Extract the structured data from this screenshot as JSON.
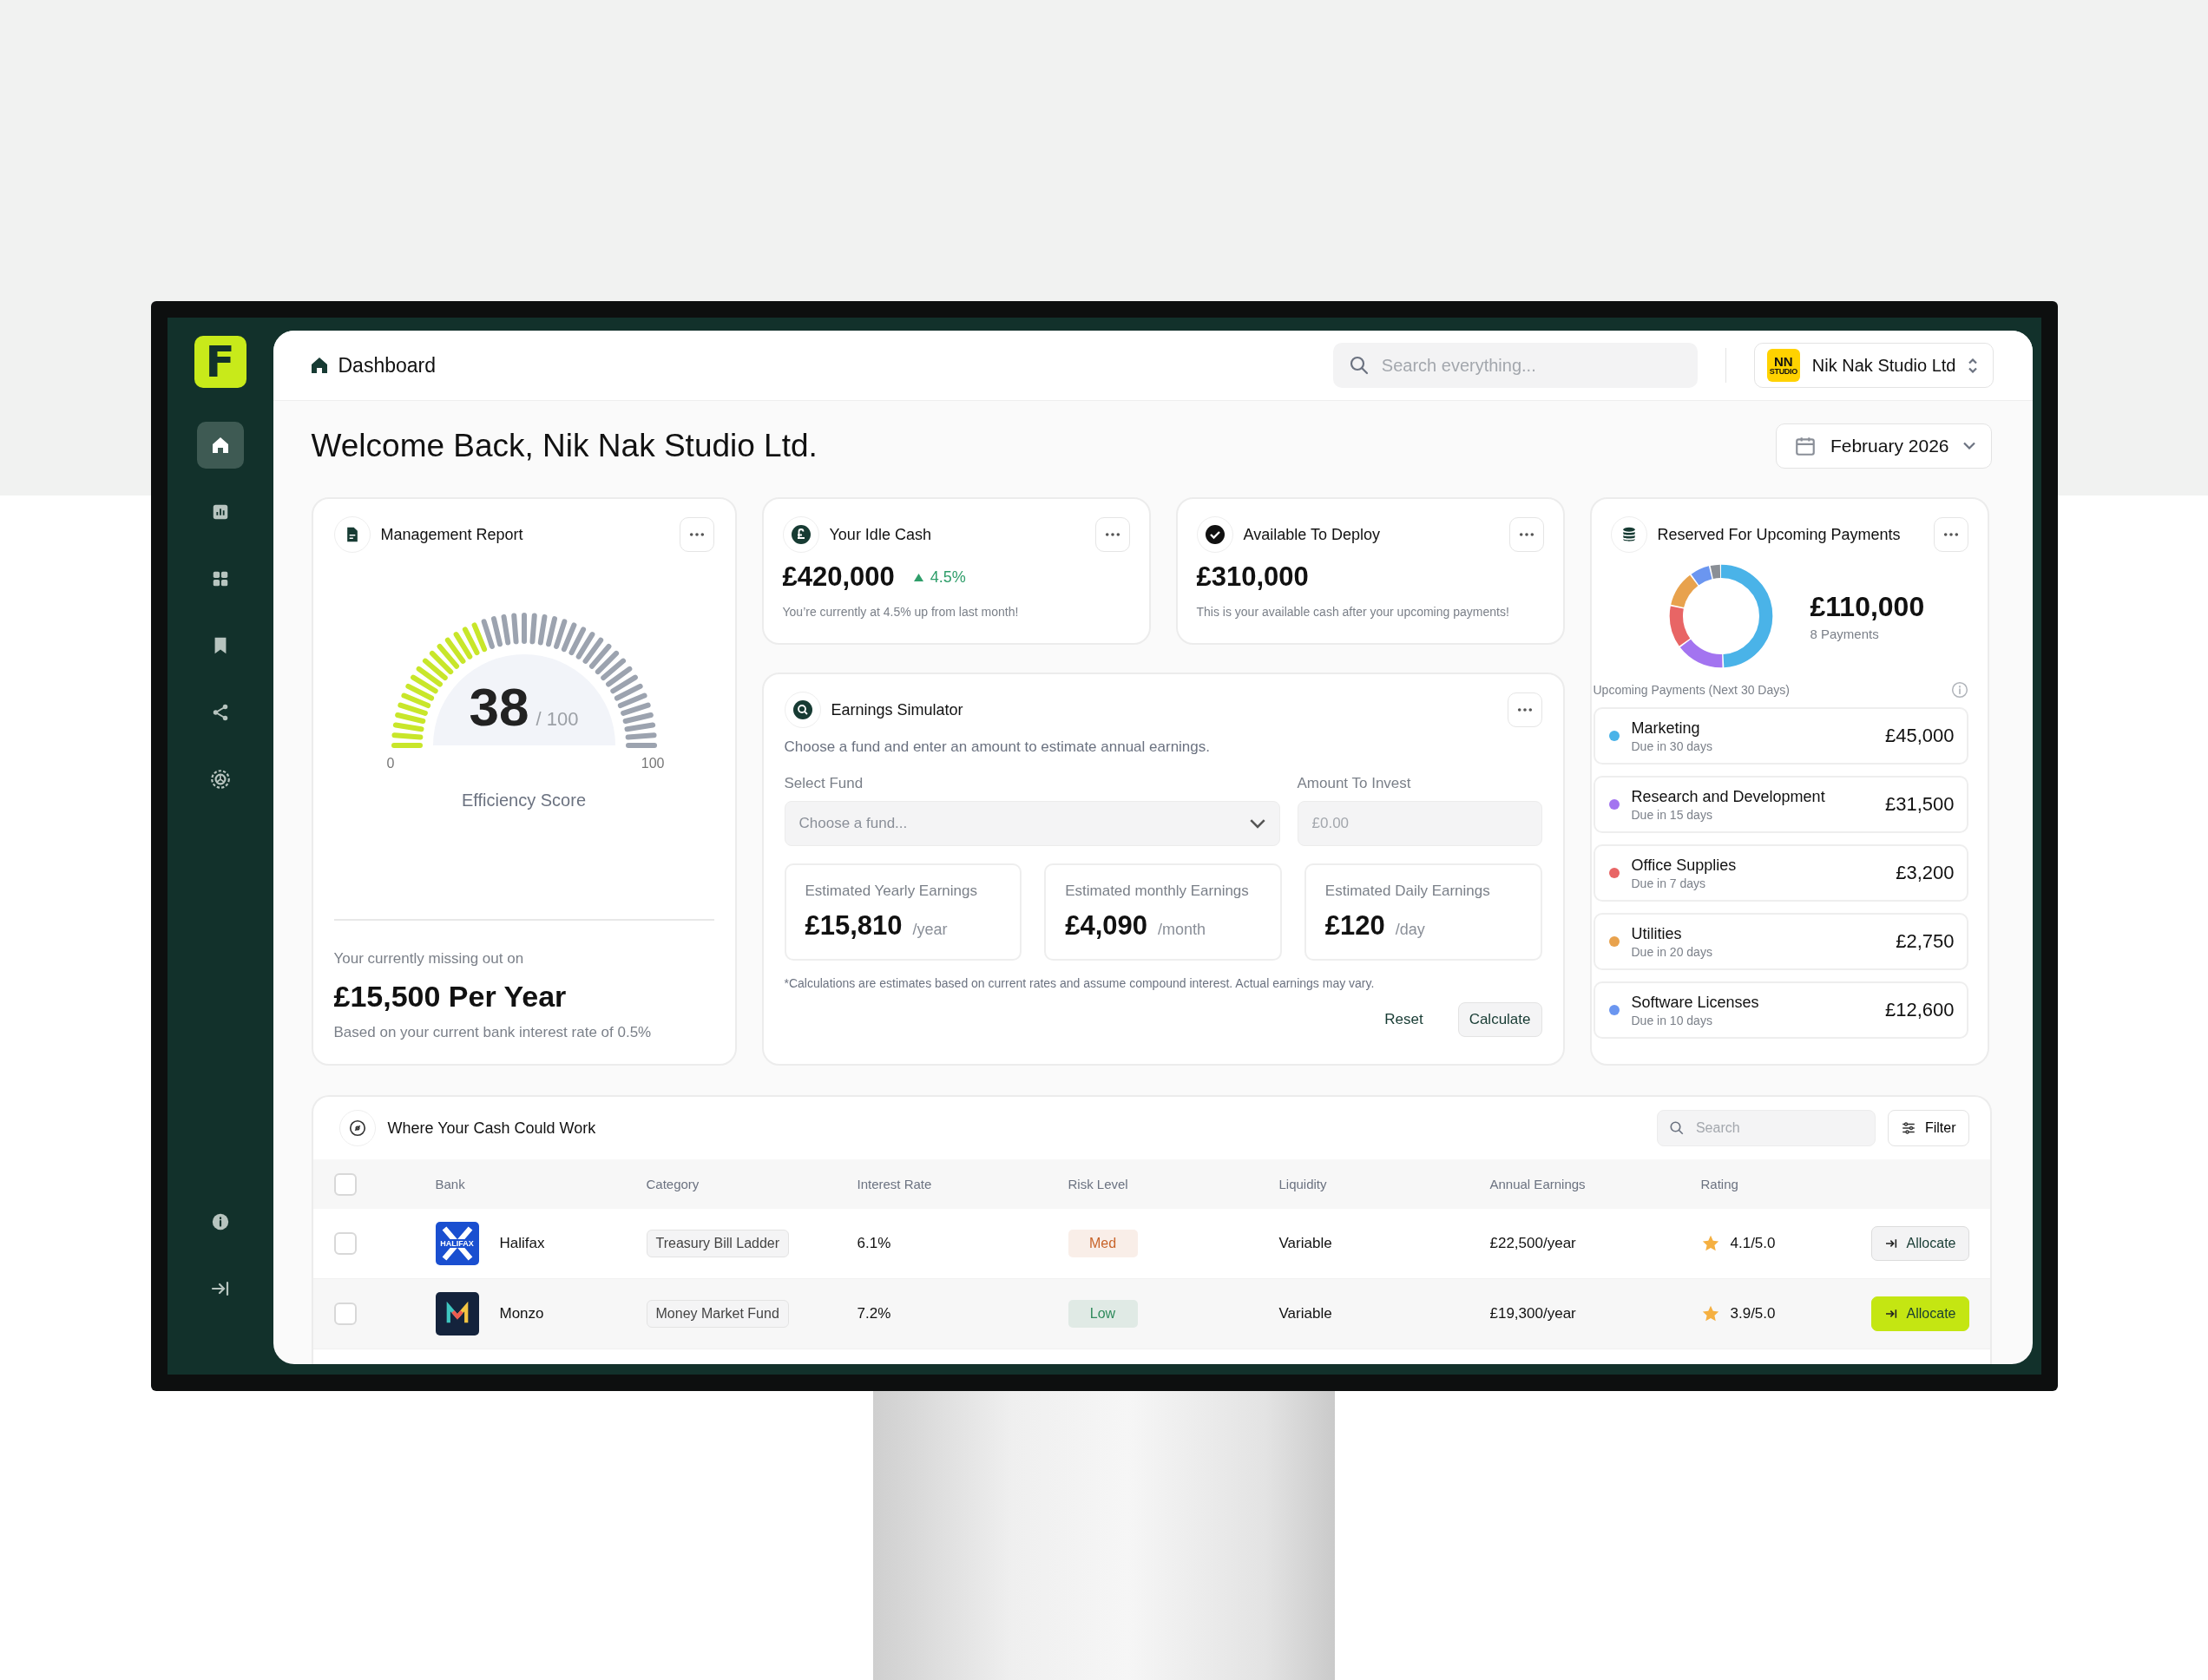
{
  "sidebar": {
    "logo": "F",
    "nav": [
      {
        "kind": "home",
        "selected": true
      },
      {
        "kind": "chart",
        "selected": false
      },
      {
        "kind": "grid",
        "selected": false
      },
      {
        "kind": "bookmark",
        "selected": false
      },
      {
        "kind": "share",
        "selected": false
      },
      {
        "kind": "settings",
        "selected": false
      }
    ],
    "footer": [
      {
        "kind": "info"
      },
      {
        "kind": "collapse"
      }
    ]
  },
  "header": {
    "title": "Dashboard",
    "search": {
      "placeholder": "Search everything..."
    },
    "company": {
      "logo_text": "NN",
      "logo_subtext": "STUDIO",
      "name": "Nik Nak Studio Ltd"
    }
  },
  "welcome": "Welcome Back, Nik Nak Studio Ltd.",
  "period": "February 2026",
  "management_report": {
    "title": "Management Report",
    "gauge": {
      "score": "38",
      "max": "/ 100",
      "min_label": "0",
      "max_label": "100",
      "level": 0.38,
      "caption": "Efficiency Score"
    },
    "missing_label": "Your currently missing out on",
    "missing_value": "£15,500 Per Year",
    "note": "Based on your current bank interest rate of 0.5%"
  },
  "idle_cash": {
    "title": "Your Idle Cash",
    "value": "£420,000",
    "change": "4.5%",
    "note": "You’re currently at 4.5% up from last month!"
  },
  "available": {
    "title": "Available To Deploy",
    "value": "£310,000",
    "note": "This is your available cash after your upcoming payments!"
  },
  "simulator": {
    "title": "Earnings Simulator",
    "description": "Choose a fund and enter an amount to estimate annual earnings.",
    "fund": {
      "label": "Select Fund",
      "placeholder": "Choose a fund..."
    },
    "amount": {
      "label": "Amount To Invest",
      "placeholder": "£0.00"
    },
    "estimates": [
      {
        "label": "Estimated Yearly Earnings",
        "value": "£15,810",
        "unit": "/year"
      },
      {
        "label": "Estimated monthly Earnings",
        "value": "£4,090",
        "unit": "/month"
      },
      {
        "label": "Estimated Daily Earnings",
        "value": "£120",
        "unit": "/day"
      }
    ],
    "footnote": "*Calculations are estimates based on current rates and assume compound interest. Actual earnings may vary.",
    "buttons": [
      {
        "label": "Reset",
        "kind": "text"
      },
      {
        "label": "Calculate",
        "kind": "outlined"
      }
    ]
  },
  "reserved": {
    "title": "Reserved For Upcoming Payments",
    "total": "£110,000",
    "count": "8 Payments",
    "list_title": "Upcoming Payments (Next 30 Days)",
    "payments": [
      {
        "name": "Marketing",
        "due": "Due in 30 days",
        "amount": "£45,000",
        "color": "#4ab3e8"
      },
      {
        "name": "Research and Development",
        "due": "Due in 15 days",
        "amount": "£31,500",
        "color": "#a374f0"
      },
      {
        "name": "Office Supplies",
        "due": "Due in 7 days",
        "amount": "£3,200",
        "color": "#e86565"
      },
      {
        "name": "Utilities",
        "due": "Due in 20 days",
        "amount": "£2,750",
        "color": "#e8a24d"
      },
      {
        "name": "Software Licenses",
        "due": "Due in 10 days",
        "amount": "£12,600",
        "color": "#6b96f0"
      }
    ]
  },
  "opportunities": {
    "title": "Where Your Cash Could Work",
    "search": {
      "placeholder": "Search"
    },
    "filter": "Filter",
    "select_all": {
      "checked": false
    },
    "columns": [
      "Bank",
      "Category",
      "Interest Rate",
      "Risk Level",
      "Liquidity",
      "Annual Earnings",
      "Rating"
    ],
    "rows": [
      {
        "checked": false,
        "selected": false,
        "logo": {
          "kind": "halifax",
          "text": "HALIFAX"
        },
        "bank": "Halifax",
        "category": "Treasury Bill Ladder",
        "rate": "6.1%",
        "risk": {
          "label": "Med",
          "color": "#c8642a"
        },
        "liquidity": "Variable",
        "earnings": "£22,500/year",
        "rating": "4.1/5.0",
        "action": "Allocate"
      },
      {
        "checked": false,
        "selected": true,
        "logo": {
          "kind": "monzo"
        },
        "bank": "Monzo",
        "category": "Money Market Fund",
        "rate": "7.2%",
        "risk": {
          "label": "Low",
          "color": "#2f8a5c"
        },
        "liquidity": "Variable",
        "earnings": "£19,300/year",
        "rating": "3.9/5.0",
        "action": "Allocate"
      }
    ]
  }
}
